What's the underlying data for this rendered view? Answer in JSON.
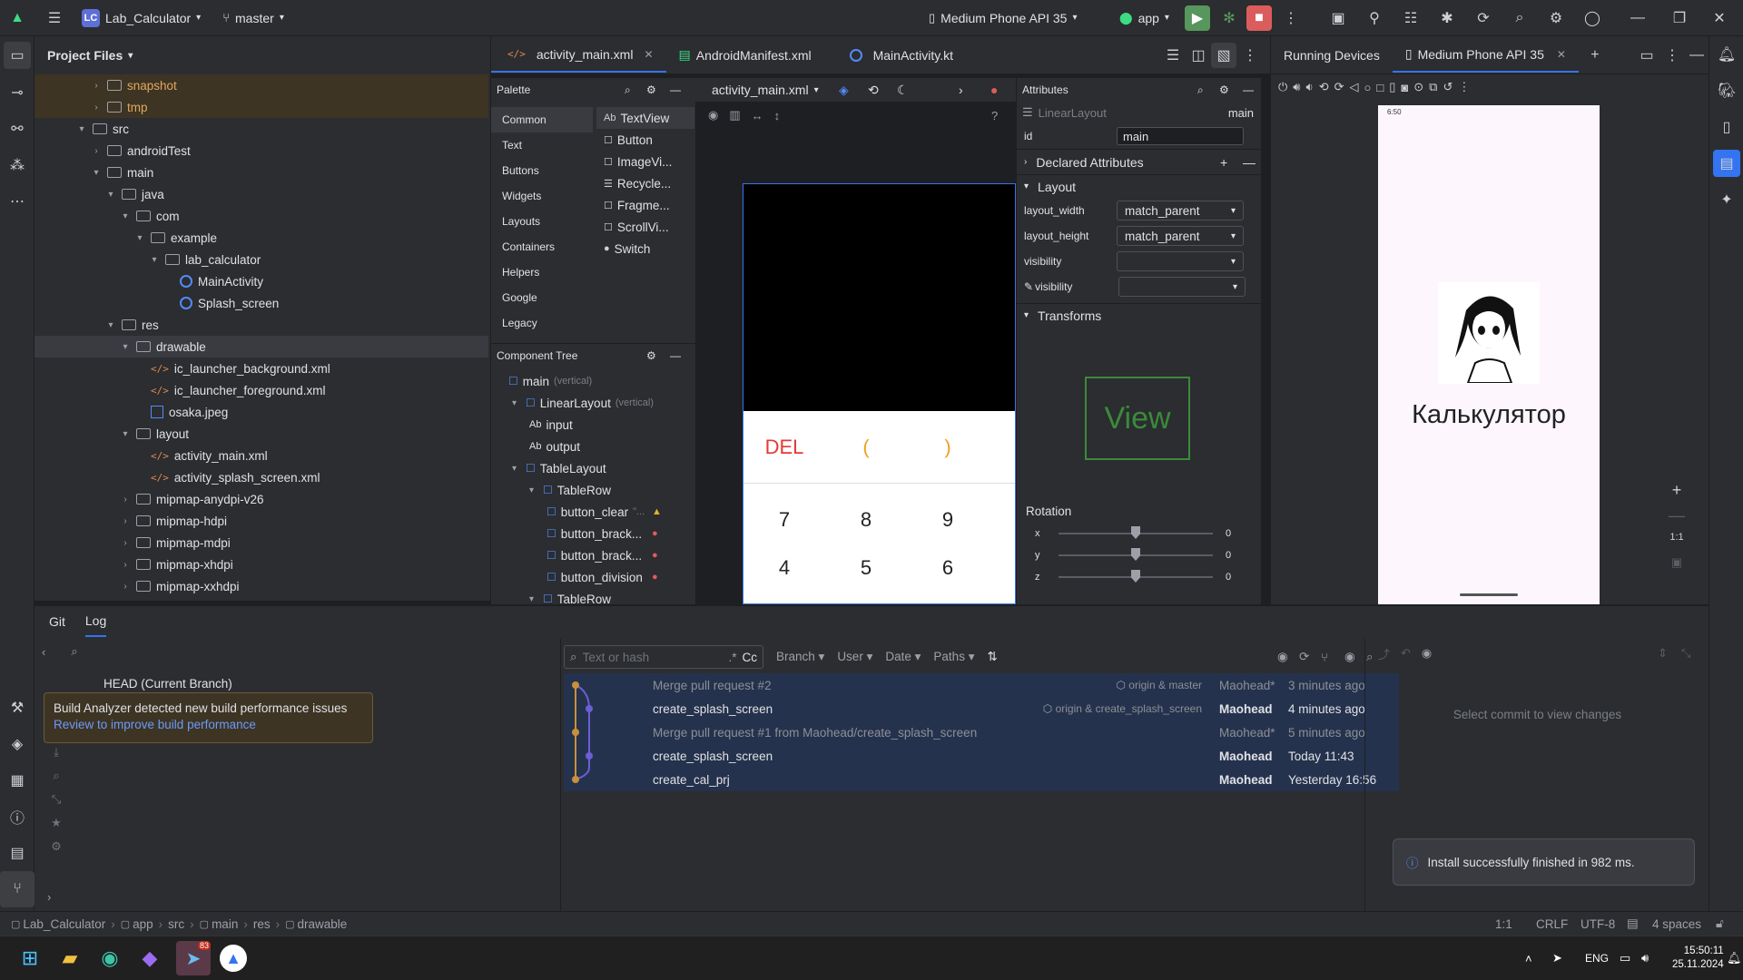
{
  "titlebar": {
    "project_badge": "LC",
    "project": "Lab_Calculator",
    "branch": "master",
    "device": "Medium Phone API 35",
    "run_config": "app"
  },
  "editor_tabs": [
    {
      "label": "activity_main.xml",
      "icon": "xml-icon"
    },
    {
      "label": "AndroidManifest.xml",
      "icon": "manifest-icon"
    },
    {
      "label": "MainActivity.kt",
      "icon": "kotlin-icon"
    }
  ],
  "project_panel": {
    "title": "Project Files",
    "items": [
      {
        "label": "snapshot",
        "level": 4,
        "type": "folder",
        "excluded": true
      },
      {
        "label": "tmp",
        "level": 4,
        "type": "folder",
        "excluded": true
      },
      {
        "label": "src",
        "level": 3,
        "type": "folder"
      },
      {
        "label": "androidTest",
        "level": 4,
        "type": "folder"
      },
      {
        "label": "main",
        "level": 4,
        "type": "folder"
      },
      {
        "label": "java",
        "level": 5,
        "type": "folder"
      },
      {
        "label": "com",
        "level": 6,
        "type": "folder"
      },
      {
        "label": "example",
        "level": 7,
        "type": "folder"
      },
      {
        "label": "lab_calculator",
        "level": 8,
        "type": "folder"
      },
      {
        "label": "MainActivity",
        "level": 9,
        "type": "kotlin"
      },
      {
        "label": "Splash_screen",
        "level": 9,
        "type": "kotlin"
      },
      {
        "label": "res",
        "level": 5,
        "type": "folder"
      },
      {
        "label": "drawable",
        "level": 6,
        "type": "folder",
        "selected": true
      },
      {
        "label": "ic_launcher_background.xml",
        "level": 7,
        "type": "xml"
      },
      {
        "label": "ic_launcher_foreground.xml",
        "level": 7,
        "type": "xml"
      },
      {
        "label": "osaka.jpeg",
        "level": 7,
        "type": "image"
      },
      {
        "label": "layout",
        "level": 6,
        "type": "folder"
      },
      {
        "label": "activity_main.xml",
        "level": 7,
        "type": "xml"
      },
      {
        "label": "activity_splash_screen.xml",
        "level": 7,
        "type": "xml"
      },
      {
        "label": "mipmap-anydpi-v26",
        "level": 6,
        "type": "folder"
      },
      {
        "label": "mipmap-hdpi",
        "level": 6,
        "type": "folder"
      },
      {
        "label": "mipmap-mdpi",
        "level": 6,
        "type": "folder"
      },
      {
        "label": "mipmap-xhdpi",
        "level": 6,
        "type": "folder"
      },
      {
        "label": "mipmap-xxhdpi",
        "level": 6,
        "type": "folder"
      }
    ]
  },
  "palette": {
    "title": "Palette",
    "categories": [
      "Common",
      "Text",
      "Buttons",
      "Widgets",
      "Layouts",
      "Containers",
      "Helpers",
      "Google",
      "Legacy"
    ],
    "widgets": [
      {
        "prefix": "Ab",
        "label": "TextView"
      },
      {
        "prefix": "☐",
        "label": "Button"
      },
      {
        "prefix": "☐",
        "label": "ImageVi..."
      },
      {
        "prefix": "☰",
        "label": "Recycle..."
      },
      {
        "prefix": "☐",
        "label": "Fragme..."
      },
      {
        "prefix": "☐",
        "label": "ScrollVi..."
      },
      {
        "prefix": "●",
        "label": "Switch"
      }
    ]
  },
  "component_tree": {
    "title": "Component Tree",
    "items": [
      {
        "label": "main",
        "hint": "(vertical)",
        "level": 0
      },
      {
        "label": "LinearLayout",
        "hint": "(vertical)",
        "level": 1
      },
      {
        "label": "input",
        "prefix": "Ab",
        "level": 2
      },
      {
        "label": "output",
        "prefix": "Ab",
        "level": 2
      },
      {
        "label": "TableLayout",
        "level": 1
      },
      {
        "label": "TableRow",
        "level": 2
      },
      {
        "label": "button_clear",
        "hint": "\"...",
        "level": 3,
        "badge": "warning"
      },
      {
        "label": "button_brack...",
        "level": 3,
        "badge": "error"
      },
      {
        "label": "button_brack...",
        "level": 3,
        "badge": "error"
      },
      {
        "label": "button_division",
        "level": 3,
        "badge": "error"
      },
      {
        "label": "TableRow",
        "level": 2
      }
    ]
  },
  "design": {
    "file": "activity_main.xml",
    "row1": [
      "DEL",
      "(",
      ")"
    ],
    "row2": [
      "7",
      "8",
      "9"
    ],
    "row3": [
      "4",
      "5",
      "6"
    ]
  },
  "attributes": {
    "title": "Attributes",
    "component": "LinearLayout",
    "id_label": "id",
    "id_value": "main",
    "declared": "Declared Attributes",
    "layout_section": "Layout",
    "fields": [
      {
        "label": "layout_width",
        "value": "match_parent"
      },
      {
        "label": "layout_height",
        "value": "match_parent"
      },
      {
        "label": "visibility",
        "value": ""
      },
      {
        "label": "visibility",
        "value": ""
      }
    ],
    "transforms": "Transforms",
    "view_preview": "View",
    "rotation": "Rotation",
    "axes": [
      {
        "axis": "x",
        "value": "0"
      },
      {
        "axis": "y",
        "value": "0"
      },
      {
        "axis": "z",
        "value": "0"
      }
    ]
  },
  "running": {
    "title": "Running Devices",
    "device_tab": "Medium Phone API 35",
    "status_time": "6:50",
    "app_title": "Калькулятор",
    "zoom": "1:1"
  },
  "bottom": {
    "tabs": [
      "Git",
      "Log"
    ],
    "head": "HEAD (Current Branch)",
    "filter_placeholder": "Text or hash",
    "filter_regex": ".*",
    "filter_case": "Cc",
    "filters": [
      "Branch",
      "User",
      "Date",
      "Paths"
    ],
    "commits": [
      {
        "msg": "Merge pull request #2",
        "tags": "origin & master",
        "author": "Maohead*",
        "time": "3 minutes ago",
        "merge": true
      },
      {
        "msg": "create_splash_screen",
        "tags": "origin & create_splash_screen",
        "author": "Maohead",
        "time": "4 minutes ago",
        "merge": false
      },
      {
        "msg": "Merge pull request #1 from Maohead/create_splash_screen",
        "tags": "",
        "author": "Maohead*",
        "time": "5 minutes ago",
        "merge": true
      },
      {
        "msg": "create_splash_screen",
        "tags": "",
        "author": "Maohead",
        "time": "Today 11:43",
        "merge": false
      },
      {
        "msg": "create_cal_prj",
        "tags": "",
        "author": "Maohead",
        "time": "Yesterday 16:56",
        "merge": false
      }
    ],
    "details_empty": "Select commit to view changes",
    "notification": "Install successfully finished in 982 ms.",
    "tooltip_title": "Build Analyzer detected new build performance issues",
    "tooltip_link": "Review to improve build performance"
  },
  "statusbar": {
    "crumbs": [
      "Lab_Calculator",
      "app",
      "src",
      "main",
      "res",
      "drawable"
    ],
    "position": "1:1",
    "line_sep": "CRLF",
    "encoding": "UTF-8",
    "indent": "4 spaces"
  },
  "taskbar": {
    "lang": "ENG",
    "time": "15:50:11",
    "date": "25.11.2024",
    "badge": "83"
  }
}
